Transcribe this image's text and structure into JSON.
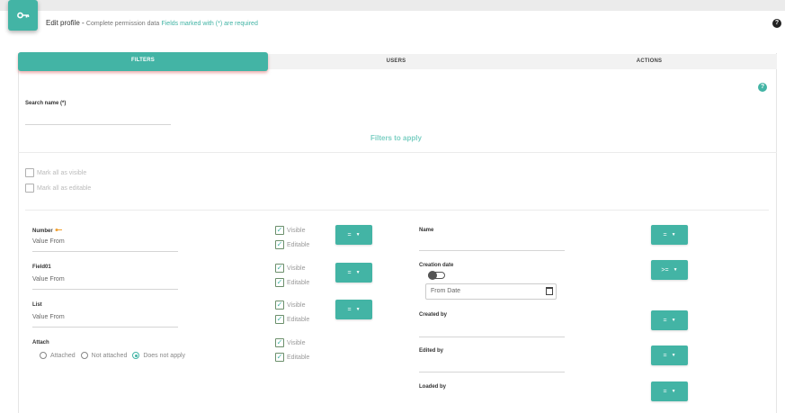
{
  "header": {
    "title": "Edit profile",
    "separator": " - ",
    "subtitle": "Complete permission data",
    "required_note": "Fields marked with (*) are required",
    "badge_icon": "key-icon",
    "help_icon": "question-circle-icon",
    "accent_color": "#43b4a5"
  },
  "tabs": [
    {
      "label": "FILTERS",
      "active": true
    },
    {
      "label": "USERS",
      "active": false
    },
    {
      "label": "ACTIONS",
      "active": false
    }
  ],
  "search": {
    "label": "Search name (*)",
    "value": ""
  },
  "filters_title": "Filters to apply",
  "mark_all": {
    "visible_label": "Mark all as visible",
    "editable_label": "Mark all as editable"
  },
  "left_fields": [
    {
      "label": "Number",
      "key_icon": "key-icon",
      "placeholder": "Value From",
      "visible_label": "Visible",
      "editable_label": "Editable",
      "operator": "=",
      "visible_checked": true,
      "editable_checked": true
    },
    {
      "label": "Field01",
      "placeholder": "Value From",
      "visible_label": "Visible",
      "editable_label": "Editable",
      "operator": "=",
      "visible_checked": true,
      "editable_checked": true
    },
    {
      "label": "List",
      "placeholder": "Value From",
      "visible_label": "Visible",
      "editable_label": "Editable",
      "operator": "=",
      "visible_checked": true,
      "editable_checked": true
    },
    {
      "label": "Attach",
      "visible_label": "Visible",
      "editable_label": "Editable",
      "visible_checked": true,
      "editable_checked": true
    }
  ],
  "attach_options": [
    {
      "label": "Attached",
      "selected": false
    },
    {
      "label": "Not attached",
      "selected": false
    },
    {
      "label": "Does not apply",
      "selected": true
    }
  ],
  "right_fields": [
    {
      "label": "Name",
      "operator": "="
    },
    {
      "label": "Creation date",
      "operator": ">=",
      "date_placeholder": "From Date",
      "calendar_icon": "calendar-icon"
    },
    {
      "label": "Created by",
      "operator": "="
    },
    {
      "label": "Edited by",
      "operator": "="
    },
    {
      "label": "Loaded by",
      "operator": "="
    }
  ],
  "caret_glyph": "▼"
}
